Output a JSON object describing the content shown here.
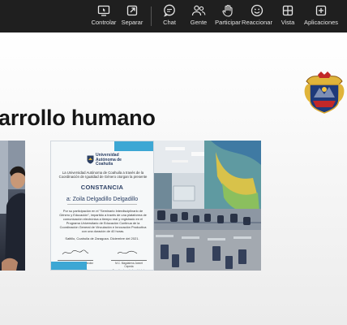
{
  "toolbar": {
    "items": [
      {
        "label": "Controlar",
        "icon": "screen-control-icon"
      },
      {
        "label": "Separar",
        "icon": "pop-out-icon"
      },
      {
        "label": "Chat",
        "icon": "chat-icon"
      },
      {
        "label": "Gente",
        "icon": "people-icon"
      },
      {
        "label": "Participar",
        "icon": "raise-hand-icon"
      },
      {
        "label": "Reaccionar",
        "icon": "smiley-icon"
      },
      {
        "label": "Vista",
        "icon": "grid-view-icon"
      },
      {
        "label": "Aplicaciones",
        "icon": "apps-plus-icon"
      }
    ]
  },
  "slide": {
    "title": "arrollo humano",
    "certificate": {
      "university": "Universidad Autónoma de Coahuila",
      "intro": "La Universidad Autónoma de Coahuila a través de la Coordinación de Igualdad de Género otorgan la presente",
      "heading": "CONSTANCIA",
      "recipient": "a: Zoila Delgadillo Delgadillo",
      "body": "Por su participación en el \"Seminario Interdisciplinario de Género y Educación\", impartido a través de una plataforma de comunicación electrónica a tiempo real y registrado en el Programa Universitario de Educación Continua de la Coordinación General de Vinculación e Innovación Productiva con una duración de 40 horas.",
      "date": "Saltillo, Coahuila de Zaragoza. Diciembre del 2021.",
      "signatories": [
        {
          "name": "M.C. Jesús Ernesto Fernández Martínez",
          "role": "Coordinador General de Vinculación e Innovación Productiva"
        },
        {
          "name": "M.C. Magdalena Jannet Cepeda",
          "role": "Coordinadora de Igualdad de Género"
        }
      ]
    }
  },
  "colors": {
    "toolbar_bg": "#1f1f1f",
    "cert_accent": "#3da7d4",
    "cert_text": "#2b3f64"
  }
}
